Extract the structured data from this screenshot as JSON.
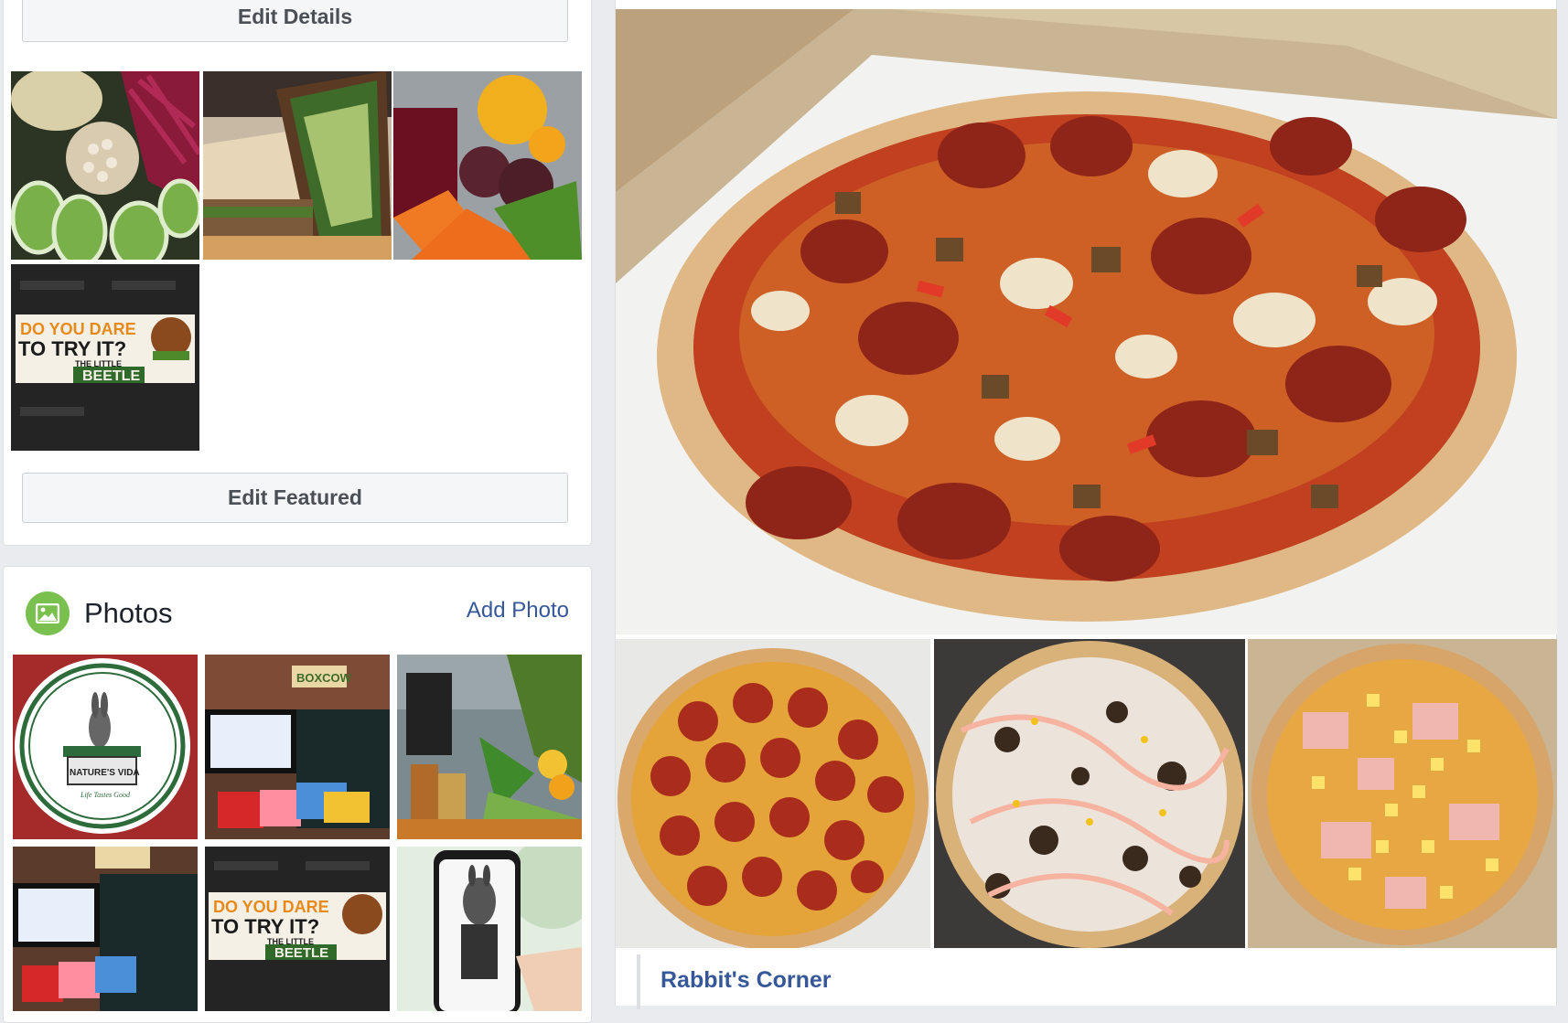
{
  "featured": {
    "edit_details_label": "Edit Details",
    "edit_featured_label": "Edit Featured",
    "promo_line1": "DO YOU DARE",
    "promo_line2": "TO TRY IT?",
    "promo_line3": "THE LITTLE",
    "promo_line4": "BEETLE"
  },
  "photos": {
    "title": "Photos",
    "add_label": "Add Photo",
    "logo_text": "NATURE'S VIDA",
    "logo_tagline": "Life Tastes Good",
    "store_sign": "BOXCOW",
    "promo_line1": "DO YOU DARE",
    "promo_line2": "TO TRY IT?",
    "promo_line3": "THE LITTLE",
    "promo_line4": "BEETLE"
  },
  "post": {
    "link_title": "Rabbit's Corner"
  },
  "colors": {
    "link": "#365899",
    "photos_icon": "#79c04f",
    "page_bg": "#e9ebee",
    "button_bg": "#f5f6f7"
  }
}
